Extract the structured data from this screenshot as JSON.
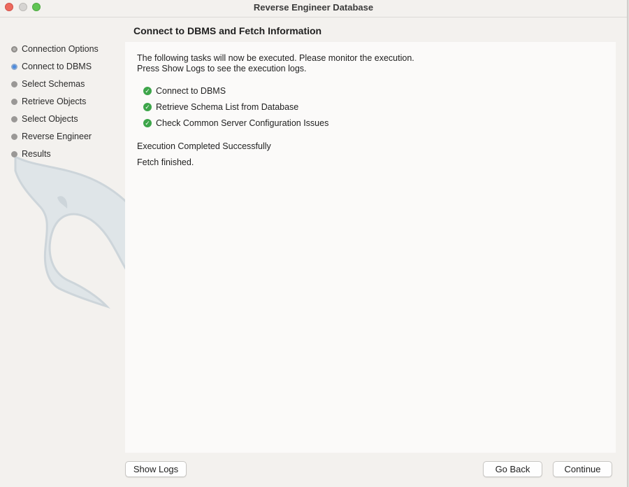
{
  "window": {
    "title": "Reverse Engineer Database"
  },
  "sidebar": {
    "steps": [
      {
        "label": "Connection Options",
        "state": "done"
      },
      {
        "label": "Connect to DBMS",
        "state": "current"
      },
      {
        "label": "Select Schemas",
        "state": "pending"
      },
      {
        "label": "Retrieve Objects",
        "state": "pending"
      },
      {
        "label": "Select Objects",
        "state": "pending"
      },
      {
        "label": "Reverse Engineer",
        "state": "pending"
      },
      {
        "label": "Results",
        "state": "pending"
      }
    ]
  },
  "main": {
    "heading": "Connect to DBMS and Fetch Information",
    "intro_line1": "The following tasks will now be executed. Please monitor the execution.",
    "intro_line2": "Press Show Logs to see the execution logs.",
    "tasks": [
      {
        "label": "Connect to DBMS",
        "icon": "check-circle-icon"
      },
      {
        "label": "Retrieve Schema List from Database",
        "icon": "check-circle-icon"
      },
      {
        "label": "Check Common Server Configuration Issues",
        "icon": "check-circle-icon"
      }
    ],
    "status": "Execution Completed Successfully",
    "message": "Fetch finished."
  },
  "footer": {
    "show_logs": "Show Logs",
    "go_back": "Go Back",
    "continue": "Continue"
  },
  "colors": {
    "success": "#3da54a",
    "current_step": "#4a8ae0",
    "close": "#ed6a5e",
    "zoom": "#61c554"
  }
}
